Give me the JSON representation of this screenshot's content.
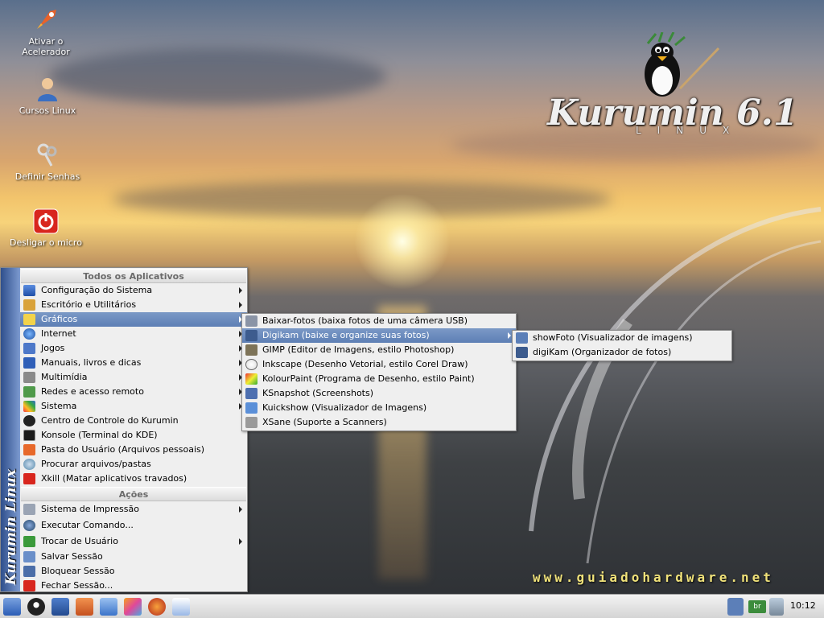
{
  "desktop": {
    "icons": [
      {
        "label": "Ativar o Acelerador",
        "icon": "rocket-icon"
      },
      {
        "label": "Cursos Linux",
        "icon": "user-icon"
      },
      {
        "label": "Definir Senhas",
        "icon": "keys-icon"
      },
      {
        "label": "Desligar o micro",
        "icon": "power-icon"
      }
    ],
    "wallpaper": {
      "logo_text": "Kurumin 6.1",
      "logo_sub": "LINUX",
      "url": "www.guiadohardware.net"
    }
  },
  "kmenu": {
    "side_text": "Kurumin Linux",
    "sections": {
      "apps_header": "Todos os Aplicativos",
      "actions_header": "Ações"
    },
    "apps": [
      {
        "label": "Configuração do Sistema",
        "icon": "monitor-icon",
        "submenu": true
      },
      {
        "label": "Escritório e Utilitários",
        "icon": "office-icon",
        "submenu": true
      },
      {
        "label": "Gráficos",
        "icon": "graphics-icon",
        "submenu": true,
        "highlighted": true
      },
      {
        "label": "Internet",
        "icon": "globe-icon",
        "submenu": true
      },
      {
        "label": "Jogos",
        "icon": "games-icon",
        "submenu": true
      },
      {
        "label": "Manuais, livros e dicas",
        "icon": "help-icon",
        "submenu": true
      },
      {
        "label": "Multimídia",
        "icon": "multimedia-icon",
        "submenu": true
      },
      {
        "label": "Redes e acesso remoto",
        "icon": "network-icon",
        "submenu": true
      },
      {
        "label": "Sistema",
        "icon": "system-icon",
        "submenu": true
      },
      {
        "label": "Centro de Controle do Kurumin",
        "icon": "tux-icon",
        "submenu": false
      },
      {
        "label": "Konsole (Terminal do KDE)",
        "icon": "terminal-icon",
        "submenu": false
      },
      {
        "label": "Pasta do Usuário (Arquivos pessoais)",
        "icon": "home-icon",
        "submenu": false
      },
      {
        "label": "Procurar arquivos/pastas",
        "icon": "search-icon",
        "submenu": false
      },
      {
        "label": "Xkill (Matar aplicativos travados)",
        "icon": "xkill-icon",
        "submenu": false
      }
    ],
    "actions": [
      {
        "label": "Sistema de Impressão",
        "icon": "printer-icon",
        "submenu": true
      },
      {
        "label": "Executar Comando...",
        "icon": "run-icon",
        "submenu": false
      },
      {
        "label": "Trocar de Usuário",
        "icon": "switch-user-icon",
        "submenu": true
      },
      {
        "label": "Salvar Sessão",
        "icon": "save-session-icon",
        "submenu": false
      },
      {
        "label": "Bloquear Sessão",
        "icon": "lock-icon",
        "submenu": false
      },
      {
        "label": "Fechar Sessão...",
        "icon": "logout-icon",
        "submenu": false
      }
    ]
  },
  "graficos_menu": [
    {
      "label": "Baixar-fotos (baixa fotos de uma câmera USB)",
      "icon": "camera-icon",
      "submenu": false
    },
    {
      "label": "Digikam (baixe e organize suas fotos)",
      "icon": "digikam-icon",
      "submenu": true,
      "highlighted": true
    },
    {
      "label": "GIMP (Editor de Imagens, estilo Photoshop)",
      "icon": "gimp-icon",
      "submenu": false
    },
    {
      "label": "Inkscape (Desenho Vetorial, estilo Corel Draw)",
      "icon": "inkscape-icon",
      "submenu": false
    },
    {
      "label": "KolourPaint (Programa de Desenho, estilo Paint)",
      "icon": "paint-icon",
      "submenu": false
    },
    {
      "label": "KSnapshot (Screenshots)",
      "icon": "snapshot-icon",
      "submenu": false
    },
    {
      "label": "Kuickshow (Visualizador de Imagens)",
      "icon": "viewer-icon",
      "submenu": false
    },
    {
      "label": "XSane (Suporte a Scanners)",
      "icon": "scanner-icon",
      "submenu": false
    }
  ],
  "digikam_menu": [
    {
      "label": "showFoto (Visualizador de imagens)",
      "icon": "showfoto-icon"
    },
    {
      "label": "digiKam (Organizador de fotos)",
      "icon": "digikam-icon"
    }
  ],
  "taskbar": {
    "clock": "10:12",
    "keyboard_layout": "br",
    "launchers": [
      "kde-menu-icon",
      "tux-icon",
      "desktops-icon",
      "home-icon",
      "window-icon",
      "butterfly-icon",
      "firefox-icon",
      "edit-icon"
    ]
  }
}
